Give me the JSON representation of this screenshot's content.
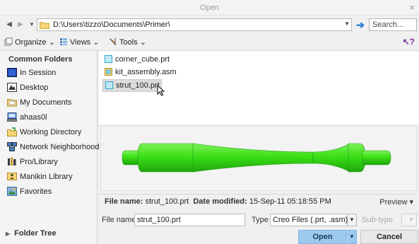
{
  "window": {
    "title": "Open",
    "close_glyph": "×"
  },
  "address": {
    "back_icon": "back-arrow-icon",
    "forward_icon": "forward-arrow-icon",
    "path": "D:\\Users\\tizzo\\Documents\\Primer\\",
    "search_placeholder": "Search..."
  },
  "toolbar": {
    "organize_label": "Organize ⌄",
    "views_label": "Views ⌄",
    "tools_label": "Tools ⌄"
  },
  "sidebar": {
    "header": "Common Folders",
    "items": [
      {
        "label": "In Session",
        "icon": "session-icon"
      },
      {
        "label": "Desktop",
        "icon": "desktop-icon"
      },
      {
        "label": "My Documents",
        "icon": "documents-icon"
      },
      {
        "label": "ahaas0l",
        "icon": "computer-icon"
      },
      {
        "label": "Working Directory",
        "icon": "working-dir-icon"
      },
      {
        "label": "Network Neighborhood",
        "icon": "network-icon"
      },
      {
        "label": "Pro/Library",
        "icon": "library-icon"
      },
      {
        "label": "Manikin Library",
        "icon": "manikin-icon"
      },
      {
        "label": "Favorites",
        "icon": "favorites-icon"
      }
    ],
    "folder_tree_label": "Folder Tree"
  },
  "files": [
    {
      "name": "corner_cube.prt",
      "icon": "part-file-icon",
      "selected": false
    },
    {
      "name": "kit_assembly.asm",
      "icon": "assembly-file-icon",
      "selected": false
    },
    {
      "name": "strut_100.prt",
      "icon": "part-file-icon",
      "selected": true
    }
  ],
  "info": {
    "file_name_label": "File name:",
    "file_name_value": "strut_100.prt",
    "date_label": "Date modified:",
    "date_value": "15-Sep-11 05:18:55 PM",
    "preview_label": "Preview ▾"
  },
  "form": {
    "file_name_label": "File name:",
    "file_name_value": "strut_100.prt",
    "type_label": "Type",
    "type_value": "Creo Files (.prt, .asm)",
    "subtype_label": "Sub-type"
  },
  "buttons": {
    "open": "Open",
    "cancel": "Cancel"
  },
  "colors": {
    "accent": "#9ec9ef",
    "model_green": "#3be016"
  }
}
